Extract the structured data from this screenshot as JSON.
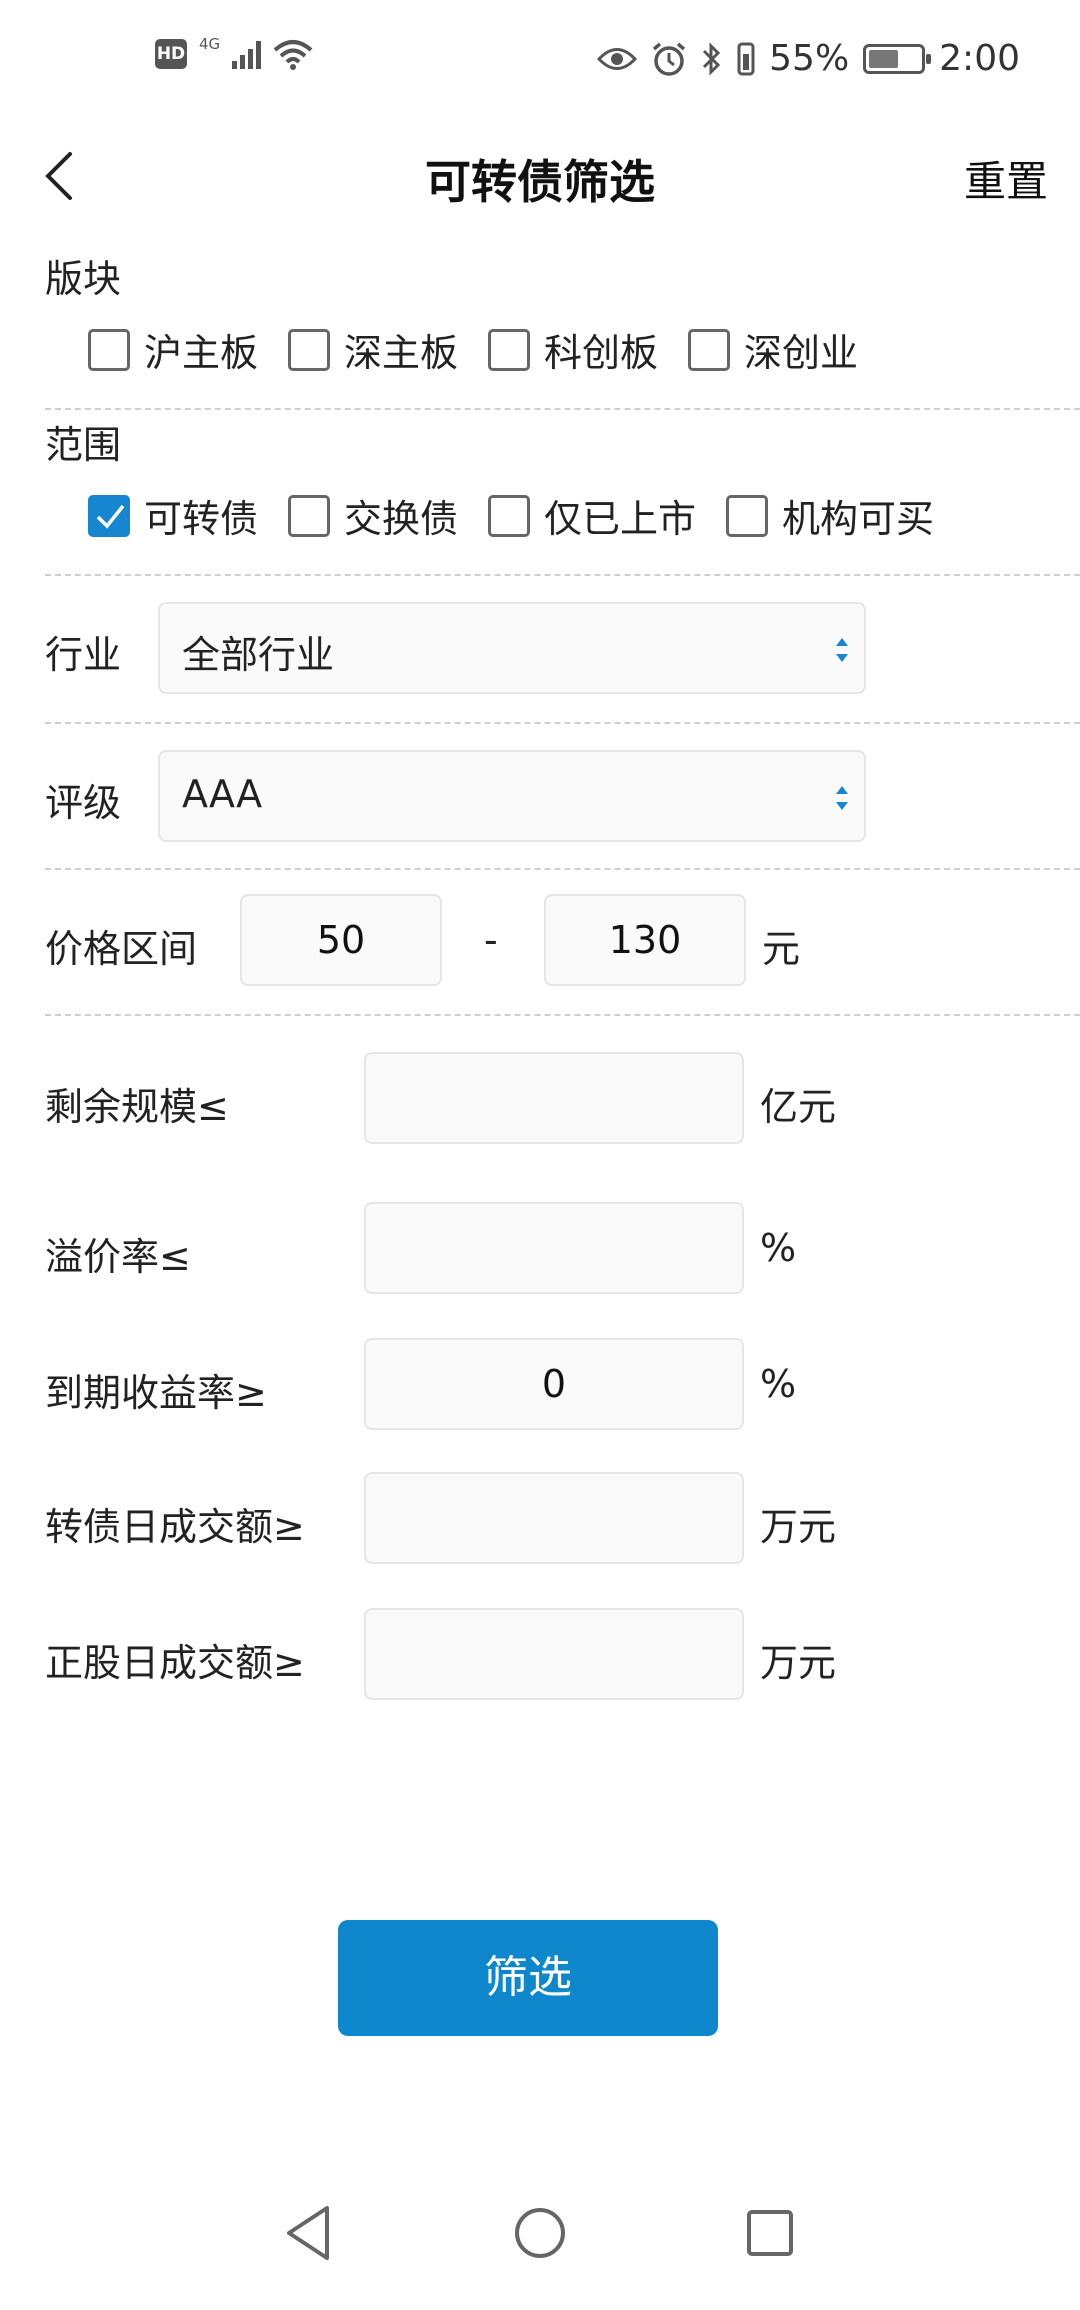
{
  "status_bar": {
    "hd": "HD",
    "network": "4G",
    "battery_percent": "55%",
    "time": "2:00"
  },
  "header": {
    "title": "可转债筛选",
    "reset_label": "重置"
  },
  "sector": {
    "title": "版块",
    "options": [
      {
        "label": "沪主板",
        "checked": false
      },
      {
        "label": "深主板",
        "checked": false
      },
      {
        "label": "科创板",
        "checked": false
      },
      {
        "label": "深创业",
        "checked": false
      }
    ]
  },
  "scope": {
    "title": "范围",
    "options": [
      {
        "label": "可转债",
        "checked": true
      },
      {
        "label": "交换债",
        "checked": false
      },
      {
        "label": "仅已上市",
        "checked": false
      },
      {
        "label": "机构可买",
        "checked": false
      }
    ]
  },
  "industry": {
    "label": "行业",
    "value": "全部行业"
  },
  "rating": {
    "label": "评级",
    "value": "AAA"
  },
  "price_range": {
    "label": "价格区间",
    "min": "50",
    "separator": "-",
    "max": "130",
    "unit": "元"
  },
  "remaining_size": {
    "label": "剩余规模≤",
    "value": "",
    "unit": "亿元"
  },
  "premium_rate": {
    "label": "溢价率≤",
    "value": "",
    "unit": "%"
  },
  "ytm": {
    "label": "到期收益率≥",
    "value": "0",
    "unit": "%"
  },
  "bond_turnover": {
    "label": "转债日成交额≥",
    "value": "",
    "unit": "万元"
  },
  "stock_turnover": {
    "label": "正股日成交额≥",
    "value": "",
    "unit": "万元"
  },
  "filter_button": "筛选",
  "colors": {
    "accent": "#0f87cd",
    "checkbox_checked": "#1686d1"
  }
}
